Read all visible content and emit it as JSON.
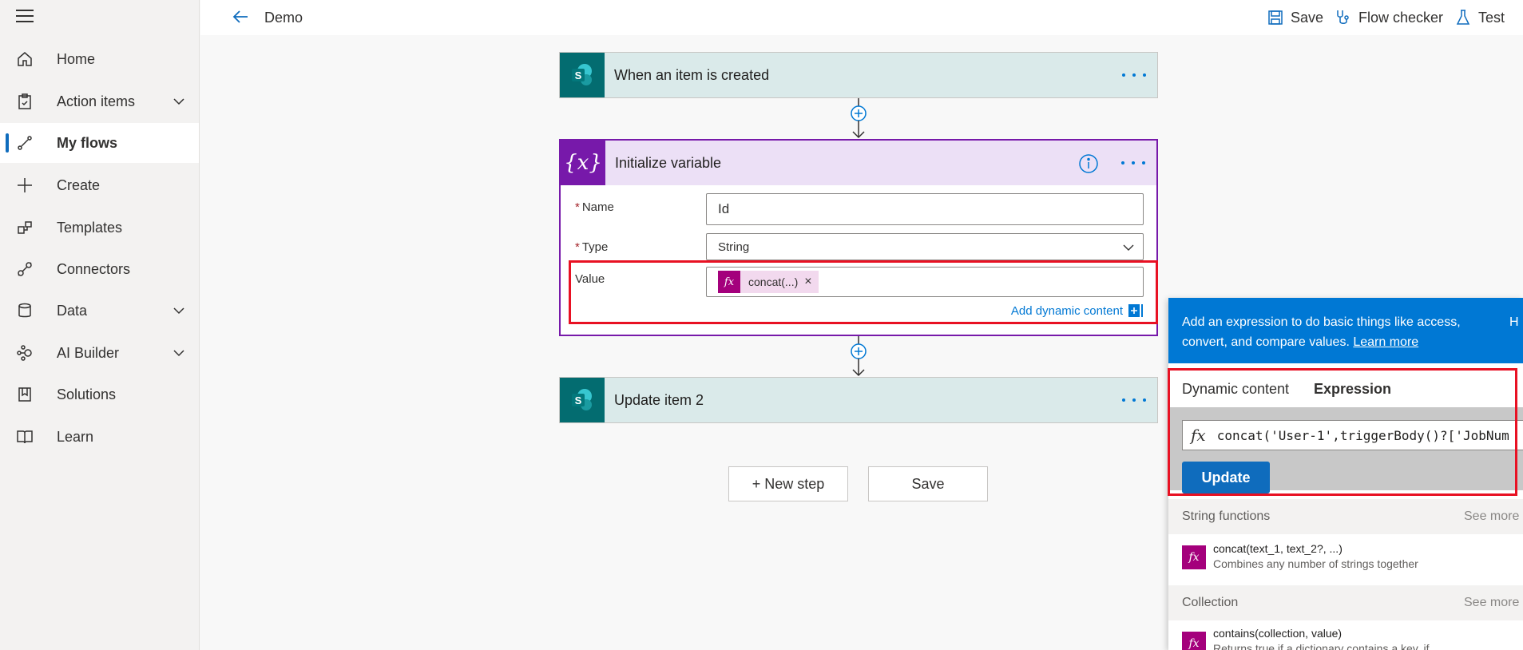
{
  "sidebar": {
    "items": [
      {
        "label": "Home",
        "icon": "home-icon"
      },
      {
        "label": "Action items",
        "icon": "clipboard-icon"
      },
      {
        "label": "My flows",
        "icon": "flows-icon"
      },
      {
        "label": "Create",
        "icon": "plus-icon"
      },
      {
        "label": "Templates",
        "icon": "templates-icon"
      },
      {
        "label": "Connectors",
        "icon": "connector-icon"
      },
      {
        "label": "Data",
        "icon": "database-icon"
      },
      {
        "label": "AI Builder",
        "icon": "ai-builder-icon"
      },
      {
        "label": "Solutions",
        "icon": "solutions-icon"
      },
      {
        "label": "Learn",
        "icon": "book-icon"
      }
    ]
  },
  "header": {
    "title": "Demo",
    "save": "Save",
    "flow_checker": "Flow checker",
    "test": "Test"
  },
  "steps": {
    "trigger": {
      "title": "When an item is created",
      "icon": "sharepoint-icon"
    },
    "init_variable": {
      "title": "Initialize variable",
      "name_label": "Name",
      "name_value": "Id",
      "type_label": "Type",
      "type_value": "String",
      "value_label": "Value",
      "token": "concat(...)",
      "token_remove": "×",
      "add_dynamic": "Add dynamic content"
    },
    "update_item": {
      "title": "Update item 2",
      "icon": "sharepoint-icon"
    }
  },
  "actions": {
    "new_step": "+ New step",
    "save": "Save"
  },
  "expression_panel": {
    "info_line1": "Add an expression to do basic things like access,",
    "info_line2": "convert, and compare values.",
    "learn_more": "Learn more",
    "info_overflow": "H",
    "tab_dynamic": "Dynamic content",
    "tab_expression": "Expression",
    "fx": "fx",
    "expression": "concat('User-1',triggerBody()?['JobNum",
    "update": "Update",
    "sections": [
      {
        "title": "String functions",
        "see_more": "See more",
        "item": {
          "name": "concat(text_1, text_2?, ...)",
          "desc": "Combines any number of strings together"
        }
      },
      {
        "title": "Collection",
        "see_more": "See more",
        "item": {
          "name": "contains(collection, value)",
          "desc": "Returns true if a dictionary contains a key, if"
        }
      }
    ]
  },
  "colors": {
    "accent": "#0078d4",
    "variable": "#7719aa",
    "sharepoint": "#036c70",
    "function": "#a4007c",
    "highlight": "#e81123"
  }
}
